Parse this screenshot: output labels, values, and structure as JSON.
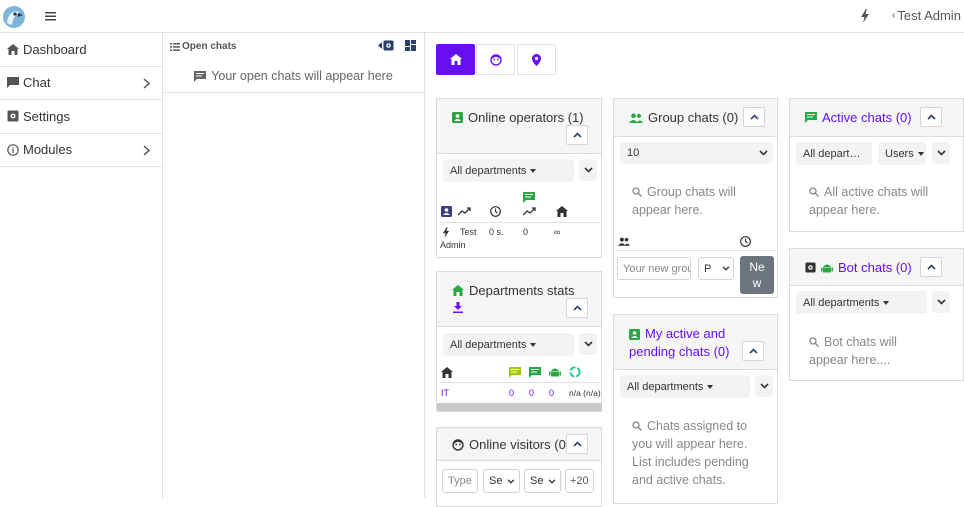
{
  "header": {
    "user_name": "Test Admin"
  },
  "sidebar": {
    "items": [
      {
        "label": "Dashboard"
      },
      {
        "label": "Chat"
      },
      {
        "label": "Settings"
      },
      {
        "label": "Modules"
      }
    ]
  },
  "open_chats": {
    "title": "Open chats",
    "empty_text": "Your open chats will appear here"
  },
  "online_operators": {
    "title": "Online operators (1)",
    "department_select": "All departments",
    "row": {
      "name_line1": "Test",
      "name_line2": "Admin",
      "time": "0 s.",
      "chats": "0",
      "max": "∞"
    }
  },
  "departments_stats": {
    "title": "Departments stats",
    "department_select": "All departments",
    "row": {
      "name": "IT",
      "c1": "0",
      "c2": "0",
      "c3": "0",
      "c4": "n/a (n/a)"
    }
  },
  "online_visitors": {
    "title": "Online visitors (0)",
    "type_placeholder": "Type",
    "sel1": "Se",
    "sel2": "Se",
    "count": "+20"
  },
  "group_chats": {
    "title": "Group chats (0)",
    "limit": "10",
    "empty_text_1": "Group chats will",
    "empty_text_2": "appear here.",
    "new_placeholder": "Your new grou",
    "type_select": "P",
    "new_button_1": "Ne",
    "new_button_2": "w"
  },
  "my_active": {
    "title_1": "My active and",
    "title_2": "pending chats (0)",
    "department_select": "All departments",
    "empty_lines": [
      "Chats assigned to",
      "you will appear here.",
      "List includes pending",
      "and active chats."
    ]
  },
  "active_chats": {
    "title": "Active chats (0)",
    "department_select": "All depart…",
    "users_select": "Users",
    "empty_text_1": "All active chats will",
    "empty_text_2": "appear here."
  },
  "bot_chats": {
    "title": "Bot chats (0)",
    "department_select": "All departments",
    "empty_text_1": "Bot chats will",
    "empty_text_2": "appear here...."
  },
  "colors": {
    "accent": "#6610f2",
    "green": "#28a745",
    "navy": "#3f3f7f"
  }
}
